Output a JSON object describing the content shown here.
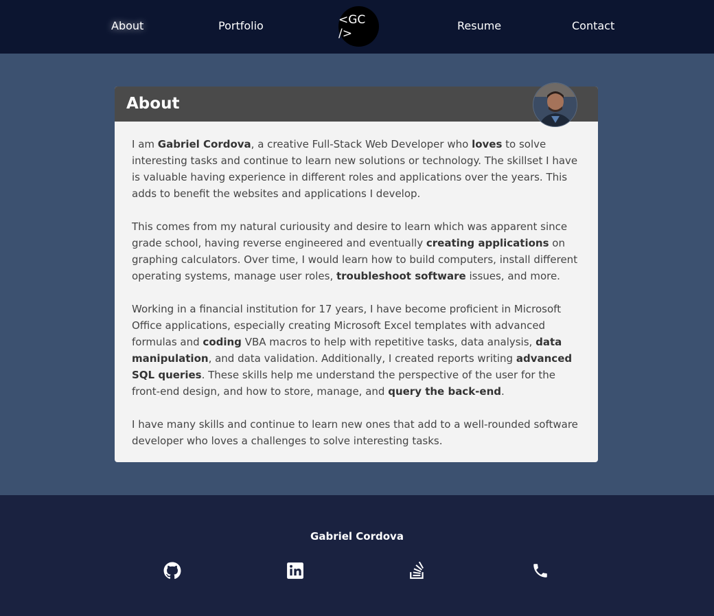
{
  "nav": {
    "items": [
      {
        "label": "About"
      },
      {
        "label": "Portfolio"
      },
      {
        "label": "Resume"
      },
      {
        "label": "Contact"
      }
    ],
    "logo": "<GC />",
    "active": "About"
  },
  "about": {
    "title": "About",
    "avatar_icon": "profile-photo",
    "p1": {
      "a": "I am ",
      "b": "Gabriel Cordova",
      "c": ", a creative Full-Stack Web Developer who ",
      "d": "loves",
      "e": " to solve interesting tasks and continue to learn new solutions or technology. The skillset I have is valuable having experience in different roles and applications over the years. This adds to benefit the websites and applications I develop."
    },
    "p2": {
      "a": "This comes from my natural curiousity and desire to learn which was apparent since grade school, having reverse engineered and eventually ",
      "b": "creating applications",
      "c": " on graphing calculators. Over time, I would learn how to build computers, install different operating systems, manage user roles, ",
      "d": "troubleshoot software",
      "e": " issues, and more."
    },
    "p3": {
      "a": "Working in a financial institution for 17 years, I have become proficient in Microsoft Office applications, especially creating Microsoft Excel templates with advanced formulas and ",
      "b": "coding",
      "c": " VBA macros to help with repetitive tasks, data analysis, ",
      "d": "data manipulation",
      "e": ", and data validation. Additionally, I created reports writing ",
      "f": "advanced SQL queries",
      "g": ". These skills help me understand the perspective of the user for the front-end design, and how to store, manage, and ",
      "h": "query the back-end",
      "i": "."
    },
    "p4": "I have many skills and continue to learn new ones that add to a well-rounded software developer who loves a challenges to solve interesting tasks."
  },
  "footer": {
    "name": "Gabriel Cordova",
    "icons": [
      "github-icon",
      "linkedin-icon",
      "stackoverflow-icon",
      "phone-icon"
    ]
  },
  "colors": {
    "nav_bg": "#0c1530",
    "page_bg": "#3c5170",
    "card_bg": "#f3f3f3",
    "card_header": "#4a4a4a",
    "footer_bg": "#1a2240"
  }
}
